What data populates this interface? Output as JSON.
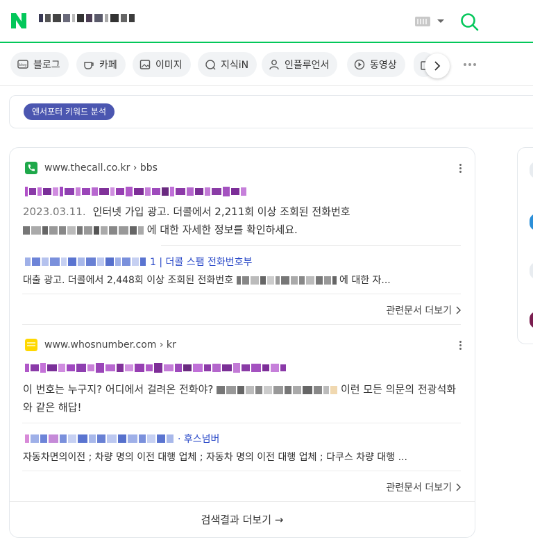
{
  "header": {
    "logo_letter": "N",
    "brand_color": "#03c75a"
  },
  "tabs": [
    {
      "label": "블로그",
      "icon": "blog-icon"
    },
    {
      "label": "카페",
      "icon": "cafe-icon"
    },
    {
      "label": "이미지",
      "icon": "image-icon"
    },
    {
      "label": "지식iN",
      "icon": "kin-icon"
    },
    {
      "label": "인플루언서",
      "icon": "person-icon"
    },
    {
      "label": "동영상",
      "icon": "play-icon"
    }
  ],
  "keyword_box": {
    "badge": "엔서포터 키워드 분석"
  },
  "results": [
    {
      "site": "www.thecall.co.kr",
      "path": "bbs",
      "date": "2023.03.11.",
      "desc_before": "인터넷 가입 광고. 더콜에서 2,211회 이상 조회된 전화번호",
      "desc_after": "에 대한 자세한 정보를 확인하세요.",
      "sub_title_suffix": "1 | 더콜 스팸 전화번호부",
      "sub_desc_before": "대출 광고. 더콜에서 2,448회 이상 조회된 전화번호",
      "sub_desc_after": "에 대한 자...",
      "related_label": "관련문서 더보기"
    },
    {
      "site": "www.whosnumber.com",
      "path": "kr",
      "desc_before": "이 번호는 누구지? 어디에서 걸려온 전화야?",
      "desc_after": "이런 모든 의문의 전광석화와 같은 해답!",
      "sub_title_suffix": "· 후스넘버",
      "sub_desc": "자동차면의이전 ; 차량 명의 이전 대행 업체 ; 자동차 명의 이전 대행 업체 ; 다쿠스 차량 대행 ...",
      "related_label": "관련문서 더보기"
    }
  ],
  "more_results_label": "검색결과 더보기 →"
}
